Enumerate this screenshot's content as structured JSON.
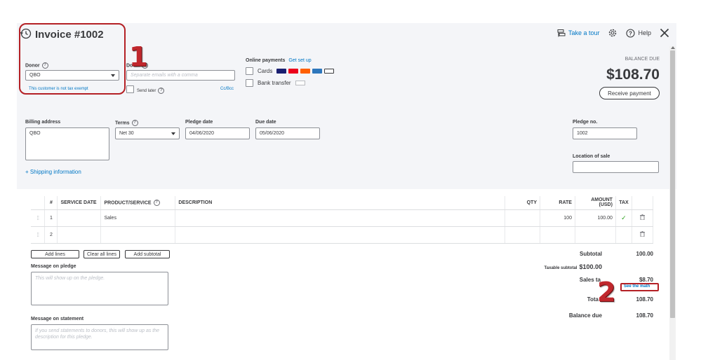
{
  "header": {
    "title": "Invoice #1002",
    "take_tour": "Take a tour",
    "help": "Help"
  },
  "donor": {
    "label": "Donor",
    "value": "QBO",
    "tax_note": "This customer is not tax exempt"
  },
  "donor_email": {
    "label": "Do      ail",
    "placeholder": "Separate emails with a comma",
    "send_later": "Send later",
    "cc_bcc": "Cc/Bcc"
  },
  "online_payments": {
    "label": "Online payments",
    "setup": "Get set up",
    "cards": "Cards",
    "bank": "Bank transfer",
    "card_colors": [
      "#1a1f71",
      "#eb001b",
      "#ff6000",
      "#2e77bc",
      "#000000"
    ]
  },
  "balance": {
    "label": "BALANCE DUE",
    "amount": "$108.70",
    "receive_button": "Receive payment"
  },
  "billing": {
    "label": "Billing address",
    "value": "QBO"
  },
  "terms": {
    "label": "Terms",
    "value": "Net 30"
  },
  "pledge_date": {
    "label": "Pledge date",
    "value": "04/06/2020"
  },
  "due_date": {
    "label": "Due date",
    "value": "05/06/2020"
  },
  "pledge_no": {
    "label": "Pledge no.",
    "value": "1002"
  },
  "location": {
    "label": "Location of sale",
    "value": ""
  },
  "shipping_link": "+ Shipping information",
  "table": {
    "headers": [
      "#",
      "SERVICE DATE",
      "PRODUCT/SERVICE",
      "DESCRIPTION",
      "QTY",
      "RATE",
      "AMOUNT (USD)",
      "TAX"
    ],
    "rows": [
      {
        "num": "1",
        "service_date": "",
        "product": "Sales",
        "description": "",
        "qty": "",
        "rate": "100",
        "amount": "100.00",
        "tax": "✓"
      },
      {
        "num": "2",
        "service_date": "",
        "product": "",
        "description": "",
        "qty": "",
        "rate": "",
        "amount": "",
        "tax": ""
      }
    ]
  },
  "buttons": {
    "add_lines": "Add lines",
    "clear_lines": "Clear all lines",
    "add_subtotal": "Add subtotal"
  },
  "message_pledge": {
    "label": "Message on pledge",
    "placeholder": "This will show up on the pledge."
  },
  "message_statement": {
    "label": "Message on statement",
    "placeholder": "If you send statements to donors, this will show up as the description for this pledge."
  },
  "totals": {
    "subtotal_label": "Subtotal",
    "subtotal_value": "100.00",
    "taxable_label": "Taxable subtotal",
    "taxable_value": "$100.00",
    "sales_tax_label": "Sales ta",
    "sales_tax_value": "$8.70",
    "see_math": "See the math",
    "total_label": "Tota",
    "total_value": "108.70",
    "balance_label": "Balance due",
    "balance_value": "108.70"
  },
  "annotations": {
    "one": "1",
    "two": "2",
    "color": "#c0272d"
  }
}
